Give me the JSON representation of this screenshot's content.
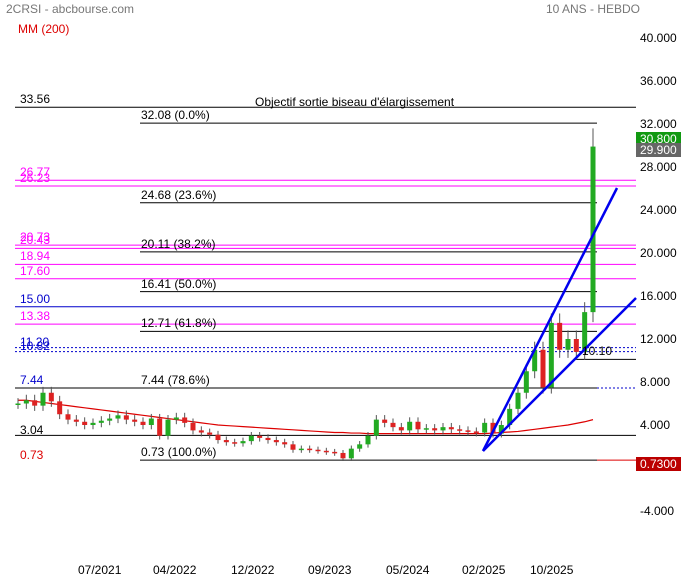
{
  "header": {
    "symbol": "2CRSI - abcbourse.com",
    "period": "10 ANS - HEBDO",
    "indicator": "MM (200)"
  },
  "colors": {
    "up": "#22aa22",
    "down": "#dd2222",
    "mm": "#dd0000",
    "wedge": "#0000ee",
    "fib": "#000000",
    "res": "#ff00ff",
    "sup": "#0000cc"
  },
  "chart_data": {
    "type": "candlestick",
    "title": "Objectif sortie biseau d'élargissement",
    "ylim": [
      -6,
      42
    ],
    "y_ticks": [
      "40.000",
      "36.000",
      "32.000",
      "28.000",
      "24.000",
      "20.000",
      "16.000",
      "12.000",
      "8.000",
      "4.000",
      "-4.000"
    ],
    "y_tick_values": [
      40,
      36,
      32,
      28,
      24,
      20,
      16,
      12,
      8,
      4,
      -4
    ],
    "x_ticks": [
      "07/2021",
      "04/2022",
      "12/2022",
      "09/2023",
      "05/2024",
      "02/2025",
      "10/2025"
    ],
    "closes": [
      6.0,
      6.3,
      5.8,
      7.0,
      6.2,
      5.0,
      4.5,
      4.3,
      4.0,
      4.2,
      4.4,
      4.6,
      4.9,
      4.5,
      4.3,
      4.0,
      4.6,
      3.0,
      4.5,
      4.7,
      4.2,
      3.5,
      3.3,
      3.1,
      2.6,
      2.4,
      2.3,
      2.5,
      3.0,
      2.8,
      2.6,
      2.4,
      2.2,
      1.7,
      1.8,
      1.7,
      1.6,
      1.5,
      1.4,
      0.9,
      1.8,
      2.2,
      3.0,
      4.5,
      4.2,
      3.8,
      3.5,
      4.3,
      3.6,
      3.7,
      3.5,
      3.8,
      3.6,
      3.5,
      3.4,
      3.3,
      4.2,
      3.2,
      4.0,
      5.5,
      7.0,
      9.0,
      11.0,
      7.5,
      13.5,
      11.0,
      12.0,
      10.8,
      14.5,
      29.9
    ],
    "mm200": [
      6.3,
      6.3,
      6.2,
      6.1,
      6.0,
      5.9,
      5.8,
      5.7,
      5.6,
      5.5,
      5.4,
      5.3,
      5.2,
      5.1,
      5.0,
      4.9,
      4.8,
      4.7,
      4.6,
      4.5,
      4.4,
      4.3,
      4.2,
      4.1,
      4.0,
      3.95,
      3.9,
      3.85,
      3.8,
      3.75,
      3.7,
      3.65,
      3.6,
      3.55,
      3.5,
      3.45,
      3.4,
      3.35,
      3.3,
      3.3,
      3.25,
      3.25,
      3.2,
      3.2,
      3.2,
      3.2,
      3.2,
      3.2,
      3.2,
      3.2,
      3.2,
      3.2,
      3.2,
      3.2,
      3.2,
      3.2,
      3.2,
      3.25,
      3.3,
      3.35,
      3.4,
      3.5,
      3.6,
      3.7,
      3.8,
      3.9,
      4.0,
      4.15,
      4.3,
      4.5
    ],
    "last_price": "29.900",
    "high_price": "30.800",
    "low_price": "0.7300",
    "levels": [
      {
        "label": "33.56",
        "value": 33.56,
        "kind": "fib"
      },
      {
        "label": "32.08  (0.0%)",
        "value": 32.08,
        "kind": "fib"
      },
      {
        "label": "24.68  (23.6%)",
        "value": 24.68,
        "kind": "fib"
      },
      {
        "label": "20.11  (38.2%)",
        "value": 20.11,
        "kind": "fib"
      },
      {
        "label": "16.41  (50.0%)",
        "value": 16.41,
        "kind": "fib"
      },
      {
        "label": "12.71  (61.8%)",
        "value": 12.71,
        "kind": "fib"
      },
      {
        "label": "7.44  (78.6%)",
        "value": 7.44,
        "kind": "fib"
      },
      {
        "label": "0.73  (100.0%)",
        "value": 0.73,
        "kind": "fib"
      },
      {
        "label": "10.10",
        "value": 10.1,
        "kind": "fib"
      },
      {
        "label": "26.77",
        "value": 26.77,
        "kind": "res"
      },
      {
        "label": "26.23",
        "value": 26.23,
        "kind": "res"
      },
      {
        "label": "20.73",
        "value": 20.73,
        "kind": "res"
      },
      {
        "label": "20.43",
        "value": 20.43,
        "kind": "res"
      },
      {
        "label": "18.94",
        "value": 18.94,
        "kind": "res"
      },
      {
        "label": "17.60",
        "value": 17.6,
        "kind": "res"
      },
      {
        "label": "13.38",
        "value": 13.38,
        "kind": "res"
      },
      {
        "label": "15.00",
        "value": 15.0,
        "kind": "sup"
      },
      {
        "label": "11.20",
        "value": 11.2,
        "kind": "supdot"
      },
      {
        "label": "10.82",
        "value": 10.82,
        "kind": "supdot"
      },
      {
        "label": "7.44",
        "value": 7.44,
        "kind": "supleft"
      },
      {
        "label": "3.04",
        "value": 3.04,
        "kind": "fibleft"
      },
      {
        "label": "0.73",
        "value": 0.73,
        "kind": "lowleft"
      }
    ]
  }
}
